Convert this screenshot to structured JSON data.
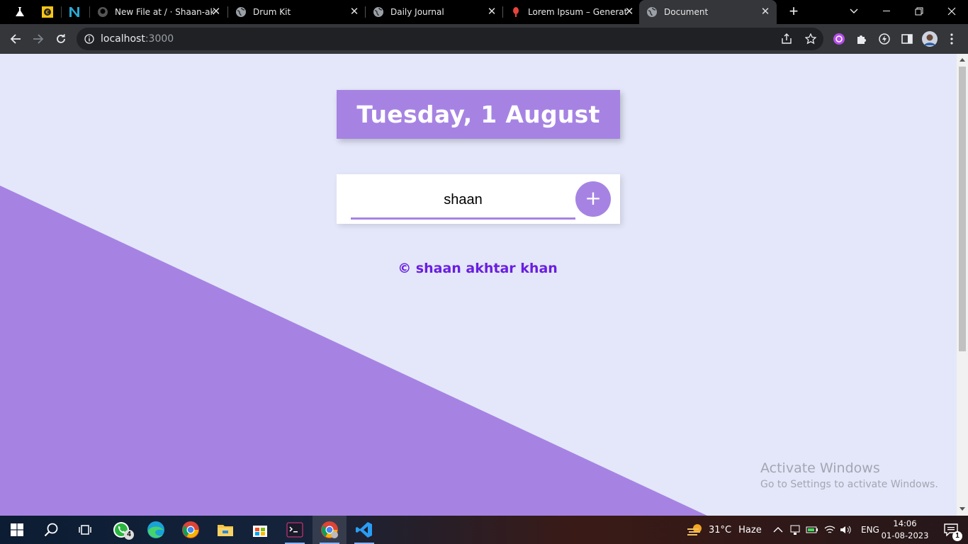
{
  "browser": {
    "tabs": [
      {
        "title": "New File at / · Shaan-akhtar",
        "active": false
      },
      {
        "title": "Drum Kit",
        "active": false
      },
      {
        "title": "Daily Journal",
        "active": false
      },
      {
        "title": "Lorem Ipsum – Generator",
        "active": false
      },
      {
        "title": "Document",
        "active": true
      }
    ],
    "url_host": "localhost",
    "url_port": ":3000"
  },
  "page": {
    "heading": "Tuesday, 1 August",
    "input_value": "shaan",
    "add_button_label": "+",
    "footer": "© shaan akhtar khan"
  },
  "watermark": {
    "line1": "Activate Windows",
    "line2": "Go to Settings to activate Windows."
  },
  "taskbar": {
    "weather_temp": "31°C",
    "weather_desc": "Haze",
    "language": "ENG",
    "time": "14:06",
    "date": "01-08-2023",
    "whatsapp_badge": "4",
    "notification_count": "1"
  },
  "colors": {
    "accent": "#a683e3",
    "background": "#e3e7f9",
    "footer_text": "#6a1ee0"
  },
  "icons": [
    "lab-icon",
    "money-icon",
    "n-logo-icon",
    "github-icon",
    "globe-icon",
    "lorem-icon",
    "windows-start-icon",
    "search-icon",
    "task-view-icon",
    "whatsapp-icon",
    "edge-icon",
    "chrome-icon",
    "file-explorer-icon",
    "store-icon",
    "terminal-icon",
    "vscode-icon"
  ]
}
